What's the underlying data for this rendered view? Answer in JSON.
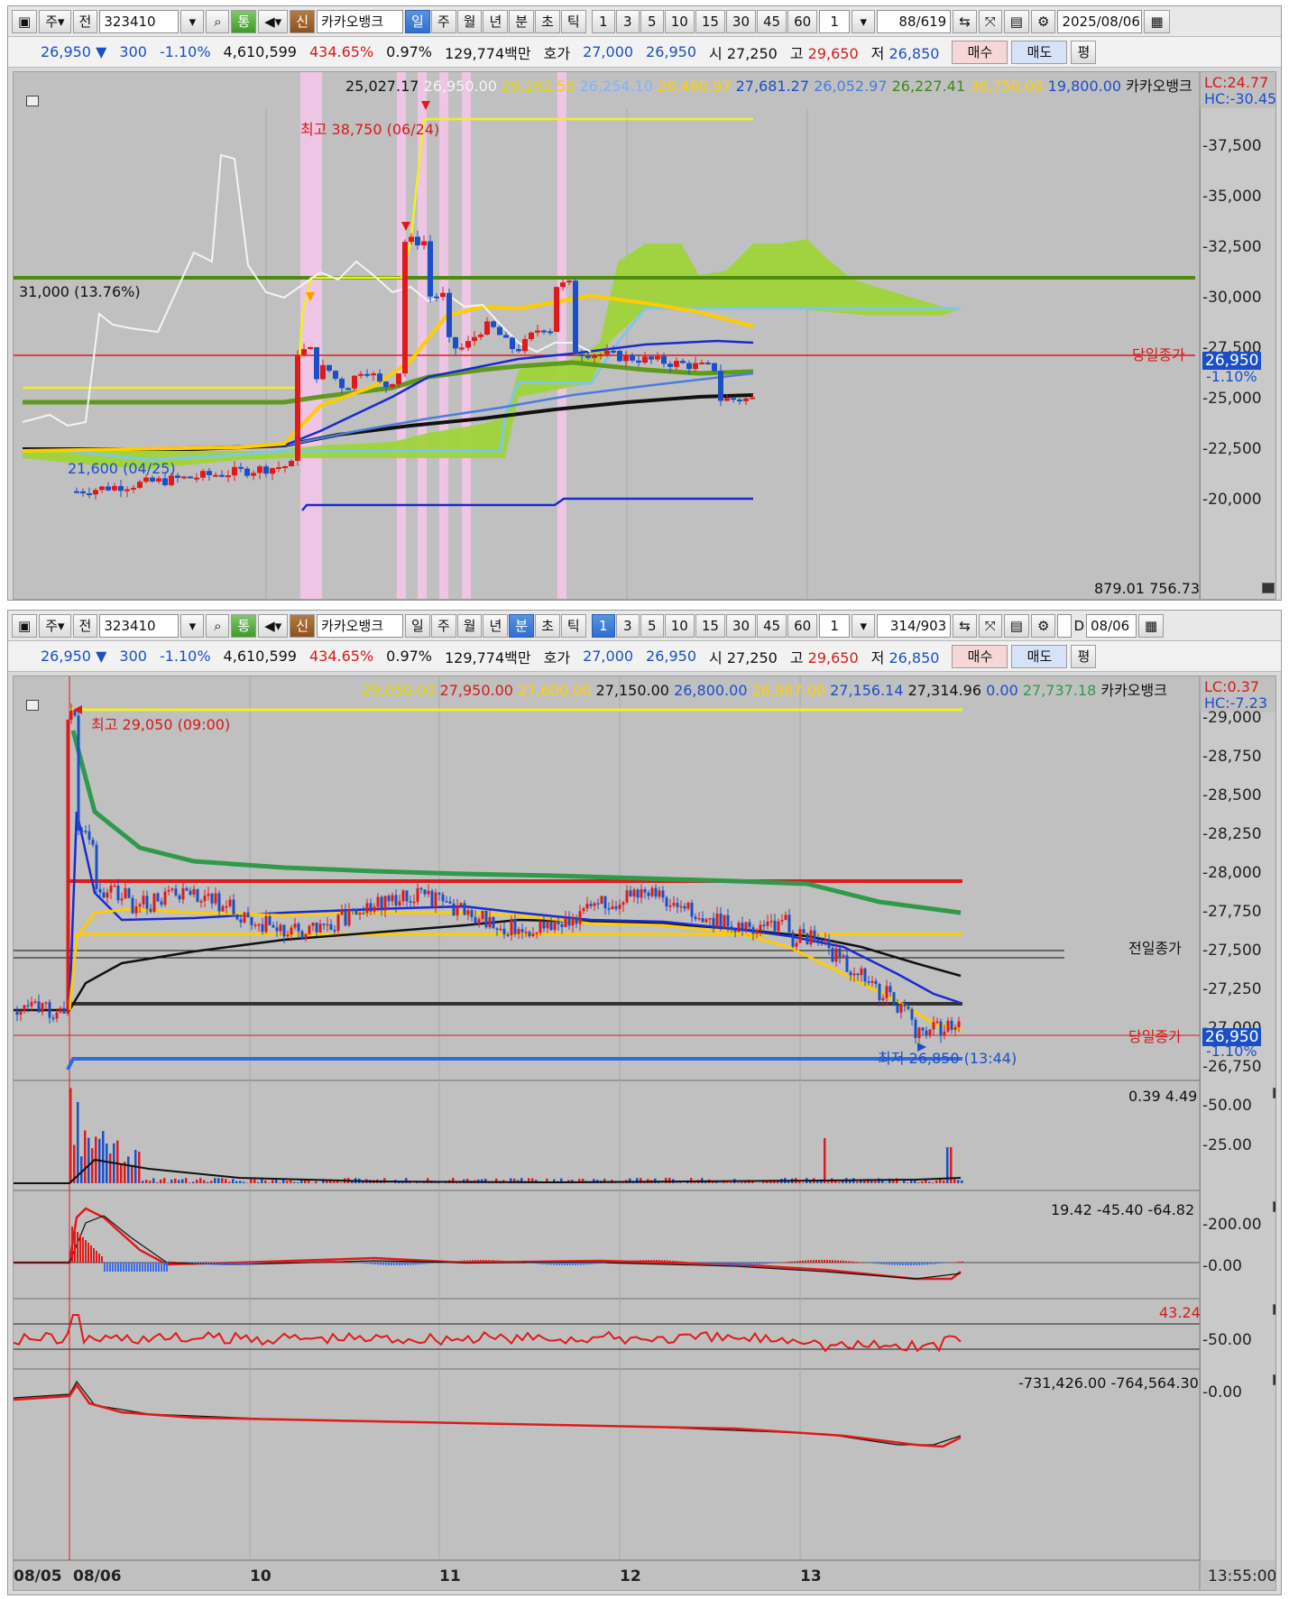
{
  "toolbar_top": {
    "type_label": "주",
    "scope_label": "전",
    "code": "323410",
    "btn_tong": "통",
    "btn_sin": "신",
    "stock_name": "카카오뱅크",
    "periods": [
      "일",
      "주",
      "월",
      "년",
      "분",
      "초",
      "틱"
    ],
    "active_period": "일",
    "intervals": [
      "1",
      "3",
      "5",
      "10",
      "15",
      "30",
      "45",
      "60"
    ],
    "interval_count": "1",
    "count": "88",
    "total": "/619",
    "date": "2025/08/06"
  },
  "info_top": {
    "price": "26,950",
    "arrow": "▼",
    "change": "300",
    "change_pct": "-1.10%",
    "volume": "4,610,599",
    "vol_ratio": "434.65%",
    "turnover": "0.97%",
    "amount": "129,774백만",
    "hoga_label": "호가",
    "ask": "27,000",
    "bid": "26,950",
    "open_label": "시",
    "open": "27,250",
    "high_label": "고",
    "high": "29,650",
    "low_label": "저",
    "low": "26,850",
    "buy": "매수",
    "sell": "매도",
    "even": "평"
  },
  "chart_top": {
    "legend": [
      "25,027.17",
      "26,950.00",
      "29,262.50",
      "26,254.10",
      "28,460.97",
      "27,681.27",
      "26,052.97",
      "26,227.41",
      "38,750.00",
      "19,800.00"
    ],
    "legend_name": "카카오뱅크",
    "lc": "LC:24.77",
    "hc": "HC:-30.45",
    "high_note": "최고 38,750 (06/24)",
    "low_note": "21,600 (04/25)",
    "level_note": "31,000 (13.76%)",
    "close_label": "당일종가",
    "cur_price": "26,950",
    "cur_pct": "-1.10%",
    "bottom_vals": "879.01  756.73",
    "yticks": [
      "37,500",
      "35,000",
      "32,500",
      "30,000",
      "27,500",
      "25,000",
      "22,500",
      "20,000"
    ]
  },
  "toolbar_bottom": {
    "type_label": "주",
    "scope_label": "전",
    "code": "323410",
    "btn_tong": "통",
    "btn_sin": "신",
    "stock_name": "카카오뱅크",
    "periods": [
      "일",
      "주",
      "월",
      "년",
      "분",
      "초",
      "틱"
    ],
    "active_period": "분",
    "intervals": [
      "1",
      "3",
      "5",
      "10",
      "15",
      "30",
      "45",
      "60"
    ],
    "active_interval": "1",
    "interval_count": "1",
    "count": "314",
    "total": "/903",
    "d_label": "D",
    "date": "08/06"
  },
  "info_bottom": {
    "price": "26,950",
    "arrow": "▼",
    "change": "300",
    "change_pct": "-1.10%",
    "volume": "4,610,599",
    "vol_ratio": "434.65%",
    "turnover": "0.97%",
    "amount": "129,774백만",
    "hoga_label": "호가",
    "ask": "27,000",
    "bid": "26,950",
    "open_label": "시",
    "open": "27,250",
    "high_label": "고",
    "high": "29,650",
    "low_label": "저",
    "low": "26,850",
    "buy": "매수",
    "sell": "매도",
    "even": "평"
  },
  "chart_bottom": {
    "legend": [
      "29,050.00",
      "27,950.00",
      "27,600.00",
      "27,150.00",
      "26,800.00",
      "26,987.00",
      "27,156.14",
      "27,314.96",
      "0.00",
      "27,737.18"
    ],
    "legend_name": "카카오뱅크",
    "lc": "LC:0.37",
    "hc": "HC:-7.23",
    "high_note": "최고 29,050 (09:00)",
    "low_note": "최저 26,850 (13:44)",
    "prev_close_label": "전일종가",
    "close_label": "당일종가",
    "cur_price": "26,950",
    "cur_pct": "-1.10%",
    "yticks": [
      "29,000",
      "28,750",
      "28,500",
      "28,250",
      "28,000",
      "27,750",
      "27,500",
      "27,250",
      "27,000",
      "26,750"
    ],
    "vol_legend": "0.39  4.49",
    "vol_ticks": [
      "50.00",
      "25.00"
    ],
    "macd_legend": "19.42  -45.40  -64.82",
    "macd_ticks": [
      "200.00",
      "0.00"
    ],
    "rsi_legend": "43.24",
    "rsi_ticks": [
      "50.00"
    ],
    "obv_legend": "-731,426.00  -764,564.30",
    "obv_ticks": [
      "0.00"
    ],
    "xticks": [
      "08/05",
      "08/06",
      "10",
      "11",
      "12",
      "13"
    ],
    "time": "13:55:00"
  }
}
